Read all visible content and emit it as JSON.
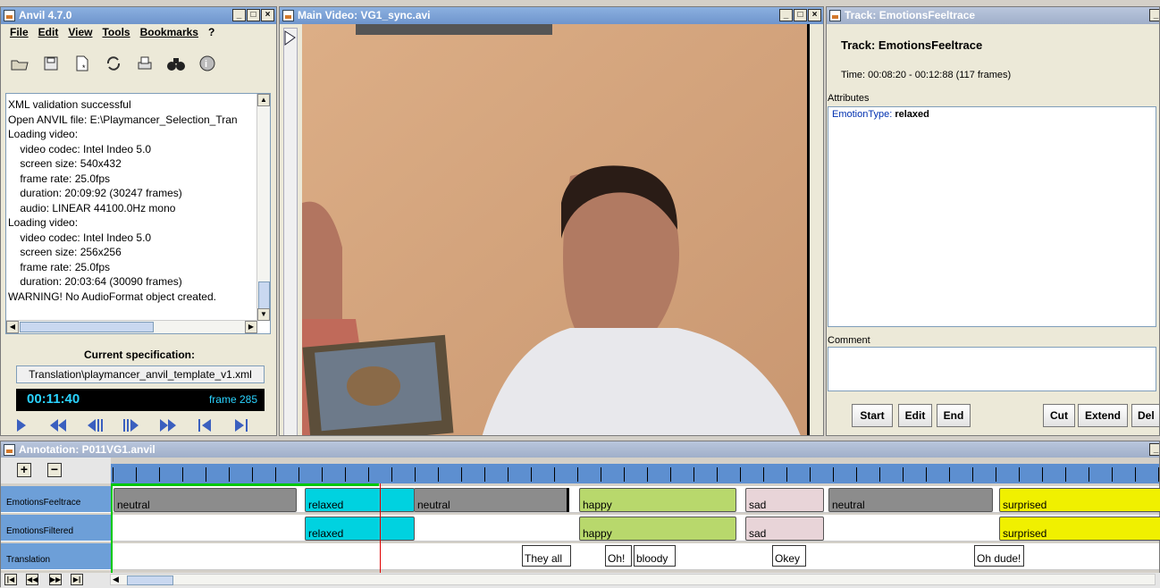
{
  "main_window": {
    "title": "Anvil 4.7.0",
    "menu": [
      "File",
      "Edit",
      "View",
      "Tools",
      "Bookmarks",
      "?"
    ],
    "toolbar_icons": [
      "open-folder-icon",
      "save-icon",
      "new-file-icon",
      "refresh-icon",
      "print-icon",
      "binoculars-icon",
      "info-icon"
    ],
    "log_lines": [
      "XML validation successful",
      "Open ANVIL file: E:\\Playmancer_Selection_Tran",
      "Loading video:",
      "    video codec: Intel Indeo 5.0",
      "    screen size: 540x432",
      "    frame rate: 25.0fps",
      "    duration: 20:09:92 (30247 frames)",
      "    audio: LINEAR 44100.0Hz mono",
      "Loading video:",
      "    video codec: Intel Indeo 5.0",
      "    screen size: 256x256",
      "    frame rate: 25.0fps",
      "    duration: 20:03:64 (30090 frames)",
      "WARNING! No AudioFormat object created."
    ],
    "spec_label": "Current specification:",
    "spec_file": "Translation\\playmancer_anvil_template_v1.xml",
    "timecode": "00:11:40",
    "frame_label": "frame 285",
    "transport": [
      "play",
      "fast-rewind",
      "step-back",
      "step-forward",
      "fast-forward",
      "go-start",
      "go-end"
    ]
  },
  "video_window": {
    "title": "Main Video: VG1_sync.avi"
  },
  "track_window": {
    "title": "Track: EmotionsFeeltrace",
    "heading": "Track: EmotionsFeeltrace",
    "time": "Time: 00:08:20 - 00:12:88 (117 frames)",
    "attributes_label": "Attributes",
    "attr_key": "EmotionType:",
    "attr_value": "relaxed",
    "comment_label": "Comment",
    "buttons": {
      "start": "Start",
      "edit": "Edit",
      "end": "End",
      "cut": "Cut",
      "extend": "Extend",
      "delete": "Del"
    }
  },
  "annotation_window": {
    "title": "Annotation: P011VG1.anvil",
    "zoom_in": "+",
    "zoom_out": "−",
    "tracks": [
      {
        "name": "EmotionsFeeltrace",
        "segments": [
          {
            "label": "neutral",
            "color": "#8c8c8c"
          },
          {
            "label": "relaxed",
            "color": "#00d2e0"
          },
          {
            "label": "neutral",
            "color": "#8c8c8c"
          },
          {
            "label": "happy",
            "color": "#b8d86c"
          },
          {
            "label": "sad",
            "color": "#e8d4d8"
          },
          {
            "label": "neutral",
            "color": "#8c8c8c"
          },
          {
            "label": "surprised",
            "color": "#f0f000"
          }
        ]
      },
      {
        "name": "EmotionsFiltered",
        "segments": [
          {
            "label": "relaxed",
            "color": "#00d2e0"
          },
          {
            "label": "happy",
            "color": "#b8d86c"
          },
          {
            "label": "sad",
            "color": "#e8d4d8"
          },
          {
            "label": "surprised",
            "color": "#f0f000"
          }
        ]
      },
      {
        "name": "Translation",
        "segments": [
          {
            "label": "They all"
          },
          {
            "label": "Oh!"
          },
          {
            "label": "bloody"
          },
          {
            "label": "Okey"
          },
          {
            "label": "Oh dude!"
          }
        ]
      }
    ],
    "nav_buttons": [
      "first",
      "prev-page",
      "next-page",
      "last"
    ]
  }
}
